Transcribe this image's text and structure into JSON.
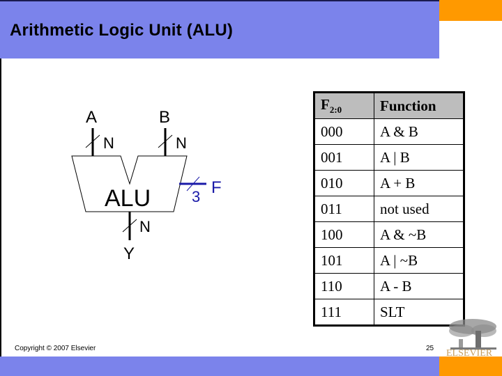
{
  "slide": {
    "title": "Arithmetic Logic Unit (ALU)",
    "footer": {
      "copyright": "Copyright © 2007 Elsevier",
      "page_number": "25",
      "logo_text": "ELSEVIER"
    },
    "colors": {
      "header_band": "#7b83eb",
      "accent": "#ff9900",
      "control_signal": "#1a1aa8",
      "table_header": "#bdbdbd"
    }
  },
  "diagram": {
    "block_label": "ALU",
    "input_a": {
      "label": "A",
      "width_label": "N"
    },
    "input_b": {
      "label": "B",
      "width_label": "N"
    },
    "output_y": {
      "label": "Y",
      "width_label": "N"
    },
    "control_f": {
      "label": "F",
      "width_label": "3"
    }
  },
  "table": {
    "headers": {
      "code": "F",
      "code_sub": "2:0",
      "function": "Function"
    },
    "rows": [
      {
        "code": "000",
        "function": "A & B"
      },
      {
        "code": "001",
        "function": "A | B"
      },
      {
        "code": "010",
        "function": "A + B"
      },
      {
        "code": "011",
        "function": "not used"
      },
      {
        "code": "100",
        "function": "A & ~B"
      },
      {
        "code": "101",
        "function": "A | ~B"
      },
      {
        "code": "110",
        "function": "A - B"
      },
      {
        "code": "111",
        "function": "SLT"
      }
    ]
  }
}
